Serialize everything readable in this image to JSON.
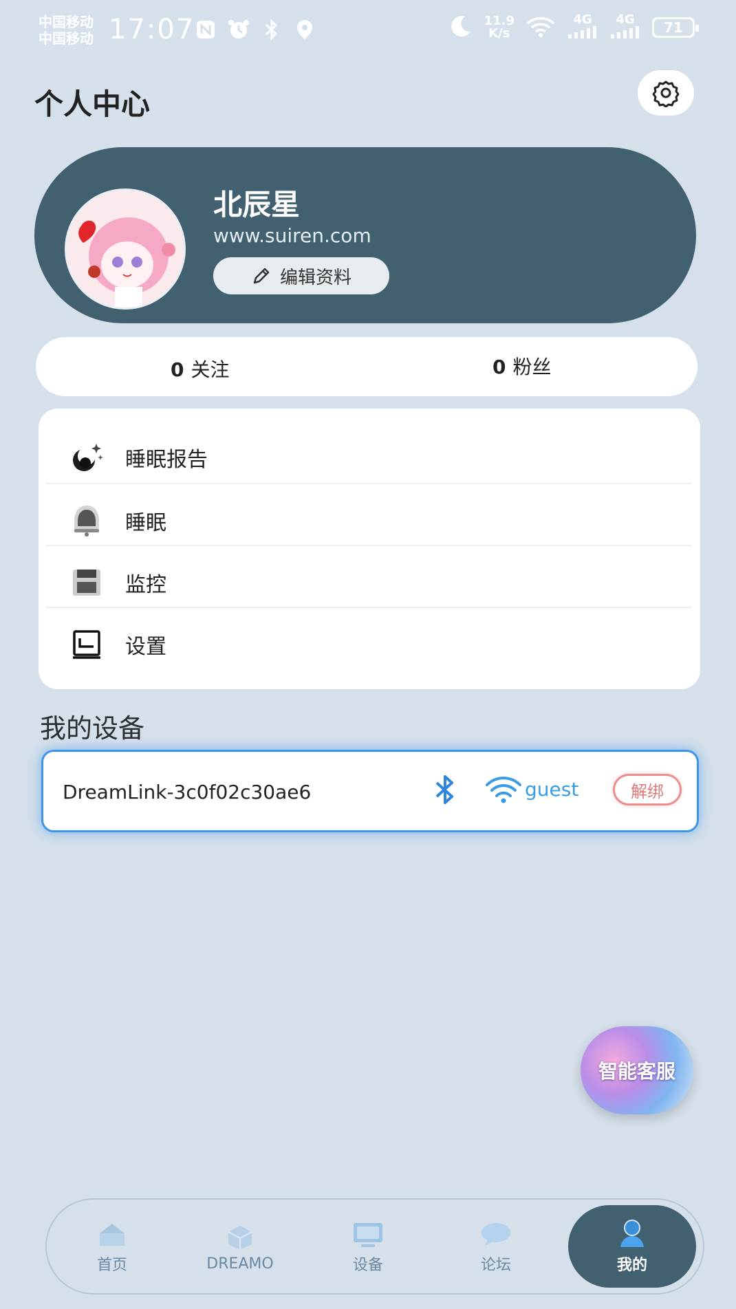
{
  "status_bar": {
    "carrier_1": "中国移动",
    "carrier_2": "中国移动",
    "time": "17:07",
    "net_speed_value": "11.9",
    "net_speed_unit": "K/s",
    "signal_1": "4G",
    "signal_2": "4G",
    "battery": "71"
  },
  "header": {
    "title": "个人中心"
  },
  "profile": {
    "name": "北辰星",
    "website": "www.suiren.com",
    "edit_label": "编辑资料"
  },
  "stats": {
    "following_count": "0",
    "following_label": "关注",
    "followers_count": "0",
    "followers_label": "粉丝"
  },
  "menu": {
    "items": [
      {
        "label": "睡眠报告",
        "icon": "moon-stars-icon"
      },
      {
        "label": "睡眠",
        "icon": "bell-icon"
      },
      {
        "label": "监控",
        "icon": "monitor-box-icon"
      },
      {
        "label": "设置",
        "icon": "settings-panel-icon"
      }
    ]
  },
  "devices": {
    "section_title": "我的设备",
    "list": [
      {
        "name": "DreamLink-3c0f02c30ae6",
        "wifi": "guest",
        "unbind_label": "解绑"
      }
    ]
  },
  "floating": {
    "service_label": "智能客服"
  },
  "bottom_nav": {
    "items": [
      {
        "label": "首页",
        "icon": "home-icon"
      },
      {
        "label": "DREAMO",
        "icon": "cube-icon"
      },
      {
        "label": "设备",
        "icon": "monitor-icon"
      },
      {
        "label": "论坛",
        "icon": "chat-icon"
      },
      {
        "label": "我的",
        "icon": "user-icon",
        "active": true
      }
    ]
  },
  "colors": {
    "background": "#d5e0ea",
    "accent_dark": "#416171",
    "device_border": "#3d95e8",
    "unbind": "#e07a7a"
  }
}
